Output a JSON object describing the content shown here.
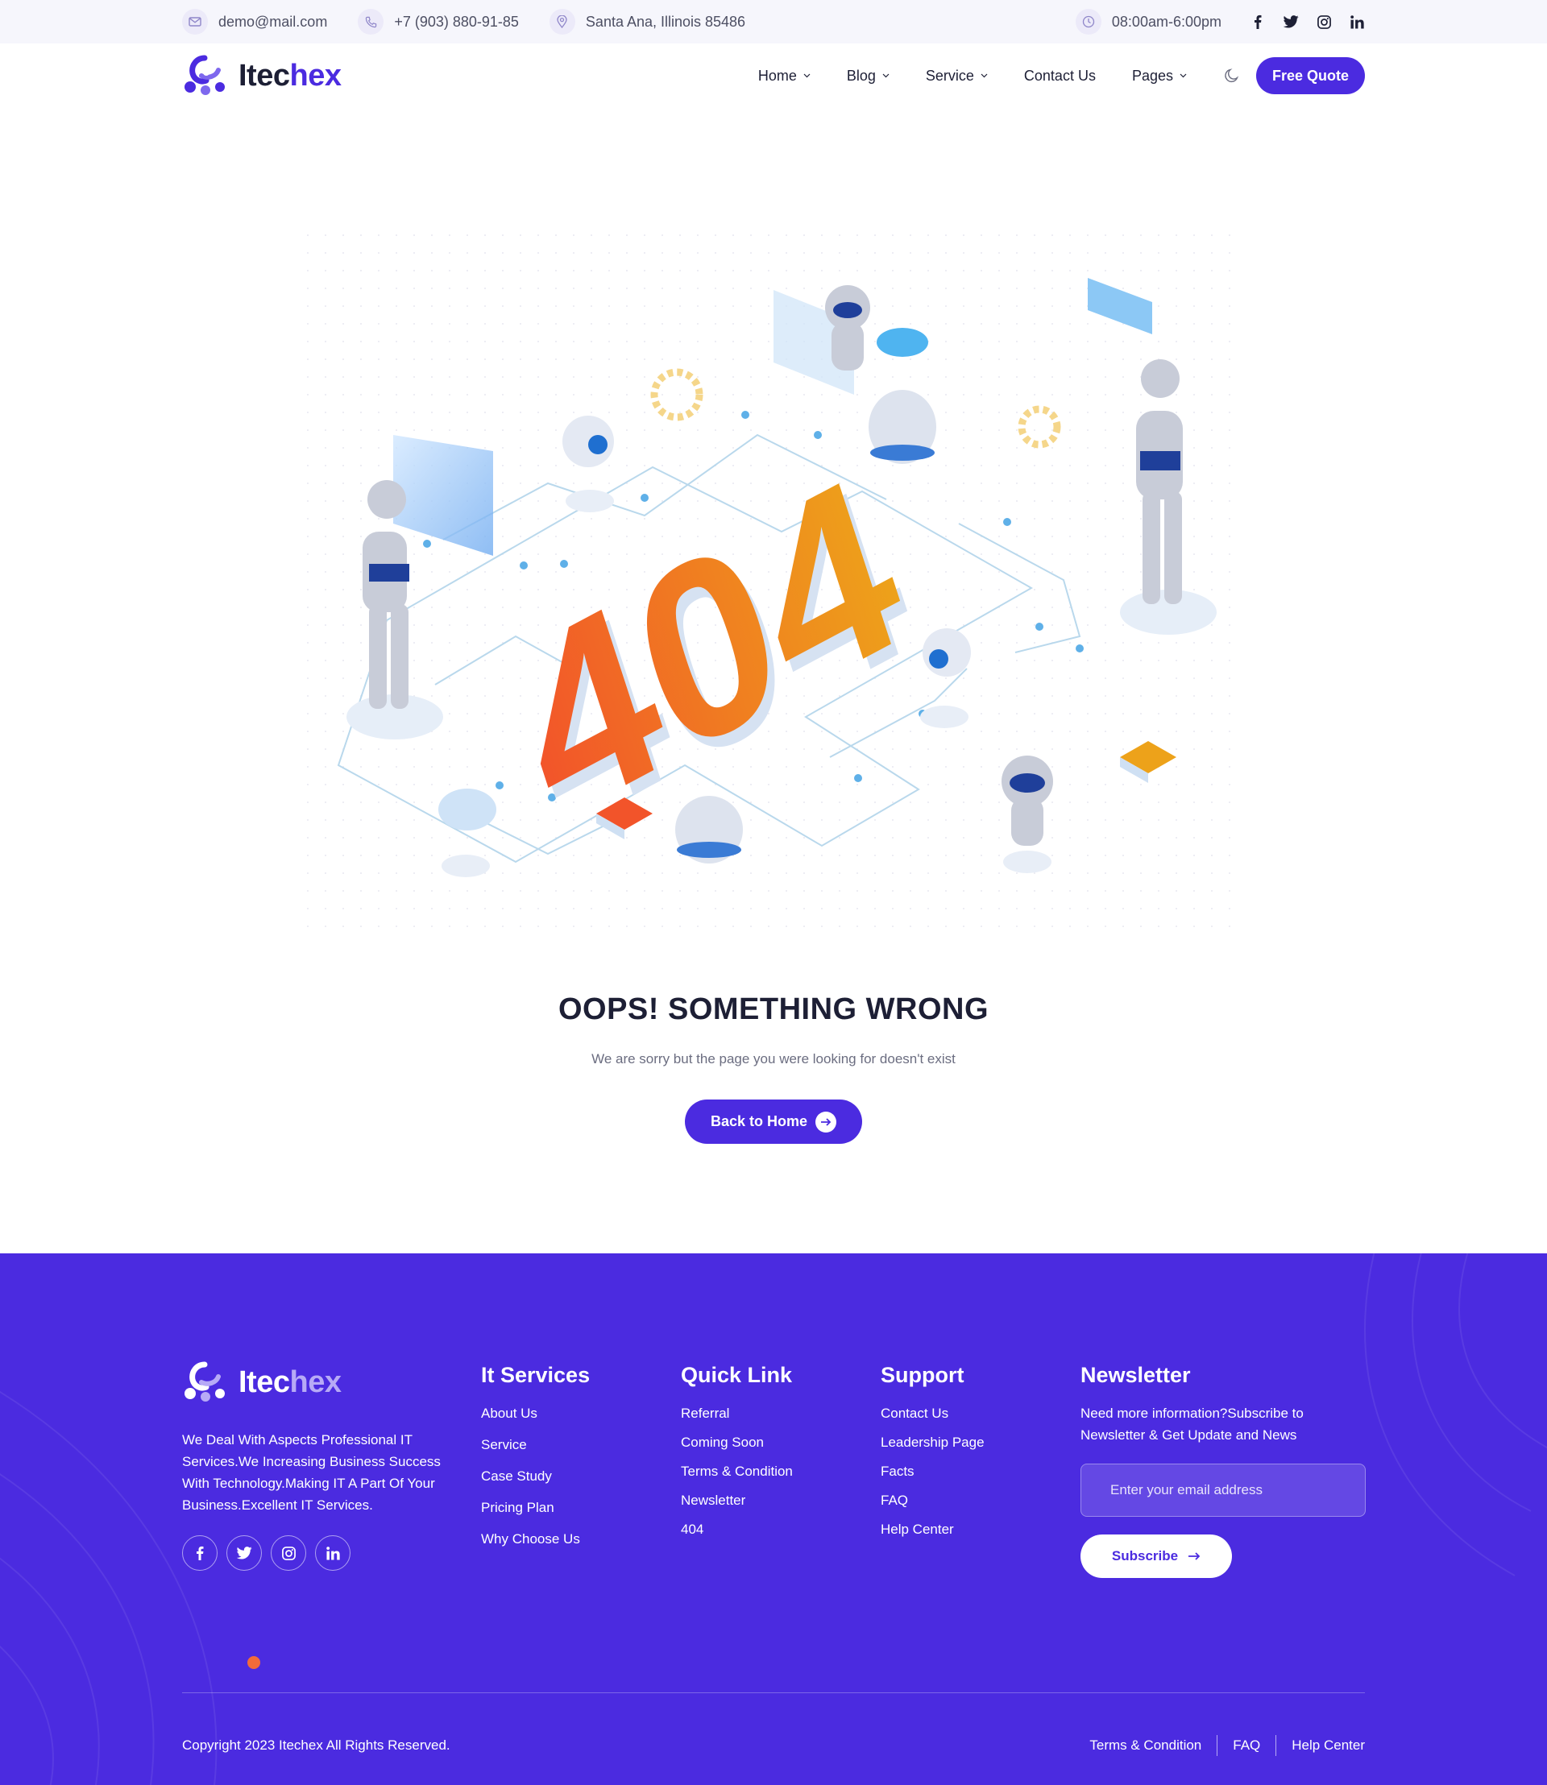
{
  "topbar": {
    "email": "demo@mail.com",
    "phone": "+7 (903) 880-91-85",
    "address": "Santa Ana, Illinois 85486",
    "hours": "08:00am-6:00pm",
    "social_icons": [
      "facebook-icon",
      "twitter-icon",
      "instagram-icon",
      "linkedin-icon"
    ]
  },
  "header": {
    "logo": {
      "part1": "Itec",
      "part2": "hex"
    },
    "nav": [
      {
        "label": "Home",
        "has_dropdown": true
      },
      {
        "label": "Blog",
        "has_dropdown": true
      },
      {
        "label": "Service",
        "has_dropdown": true
      },
      {
        "label": "Contact Us",
        "has_dropdown": false
      },
      {
        "label": "Pages",
        "has_dropdown": true
      }
    ],
    "cta": "Free Quote"
  },
  "hero": {
    "illustration_text": "404",
    "title": "OOPS! SOMETHING WRONG",
    "subtitle": "We are sorry but the page you were looking for doesn't exist",
    "button": "Back to Home"
  },
  "footer": {
    "logo": {
      "part1": "Itec",
      "part2": "hex"
    },
    "about": "We Deal With Aspects Professional IT Services.We Increasing Business Success With Technology.Making IT A Part Of Your Business.Excellent IT Services.",
    "social_icons": [
      "facebook-icon",
      "twitter-icon",
      "instagram-icon",
      "linkedin-icon"
    ],
    "it_services": {
      "title": "It Services",
      "links": [
        "About Us",
        "Service",
        "Case Study",
        "Pricing Plan",
        "Why Choose Us"
      ]
    },
    "quick_link": {
      "title": "Quick Link",
      "links": [
        "Referral",
        "Coming Soon",
        "Terms & Condition",
        "Newsletter",
        "404"
      ]
    },
    "support": {
      "title": "Support",
      "links": [
        "Contact Us",
        "Leadership Page",
        "Facts",
        "FAQ",
        "Help Center"
      ]
    },
    "newsletter": {
      "title": "Newsletter",
      "text": "Need more information?Subscribe to Newsletter & Get Update and News",
      "placeholder": "Enter your email address",
      "button": "Subscribe"
    },
    "copyright": "Copyright 2023 Itechex All Rights Reserved.",
    "bottom_links": [
      "Terms & Condition",
      "FAQ",
      "Help Center"
    ]
  },
  "colors": {
    "brand": "#4b2be0",
    "accent_orange": "#f26b3a",
    "heading": "#1d1f35"
  }
}
